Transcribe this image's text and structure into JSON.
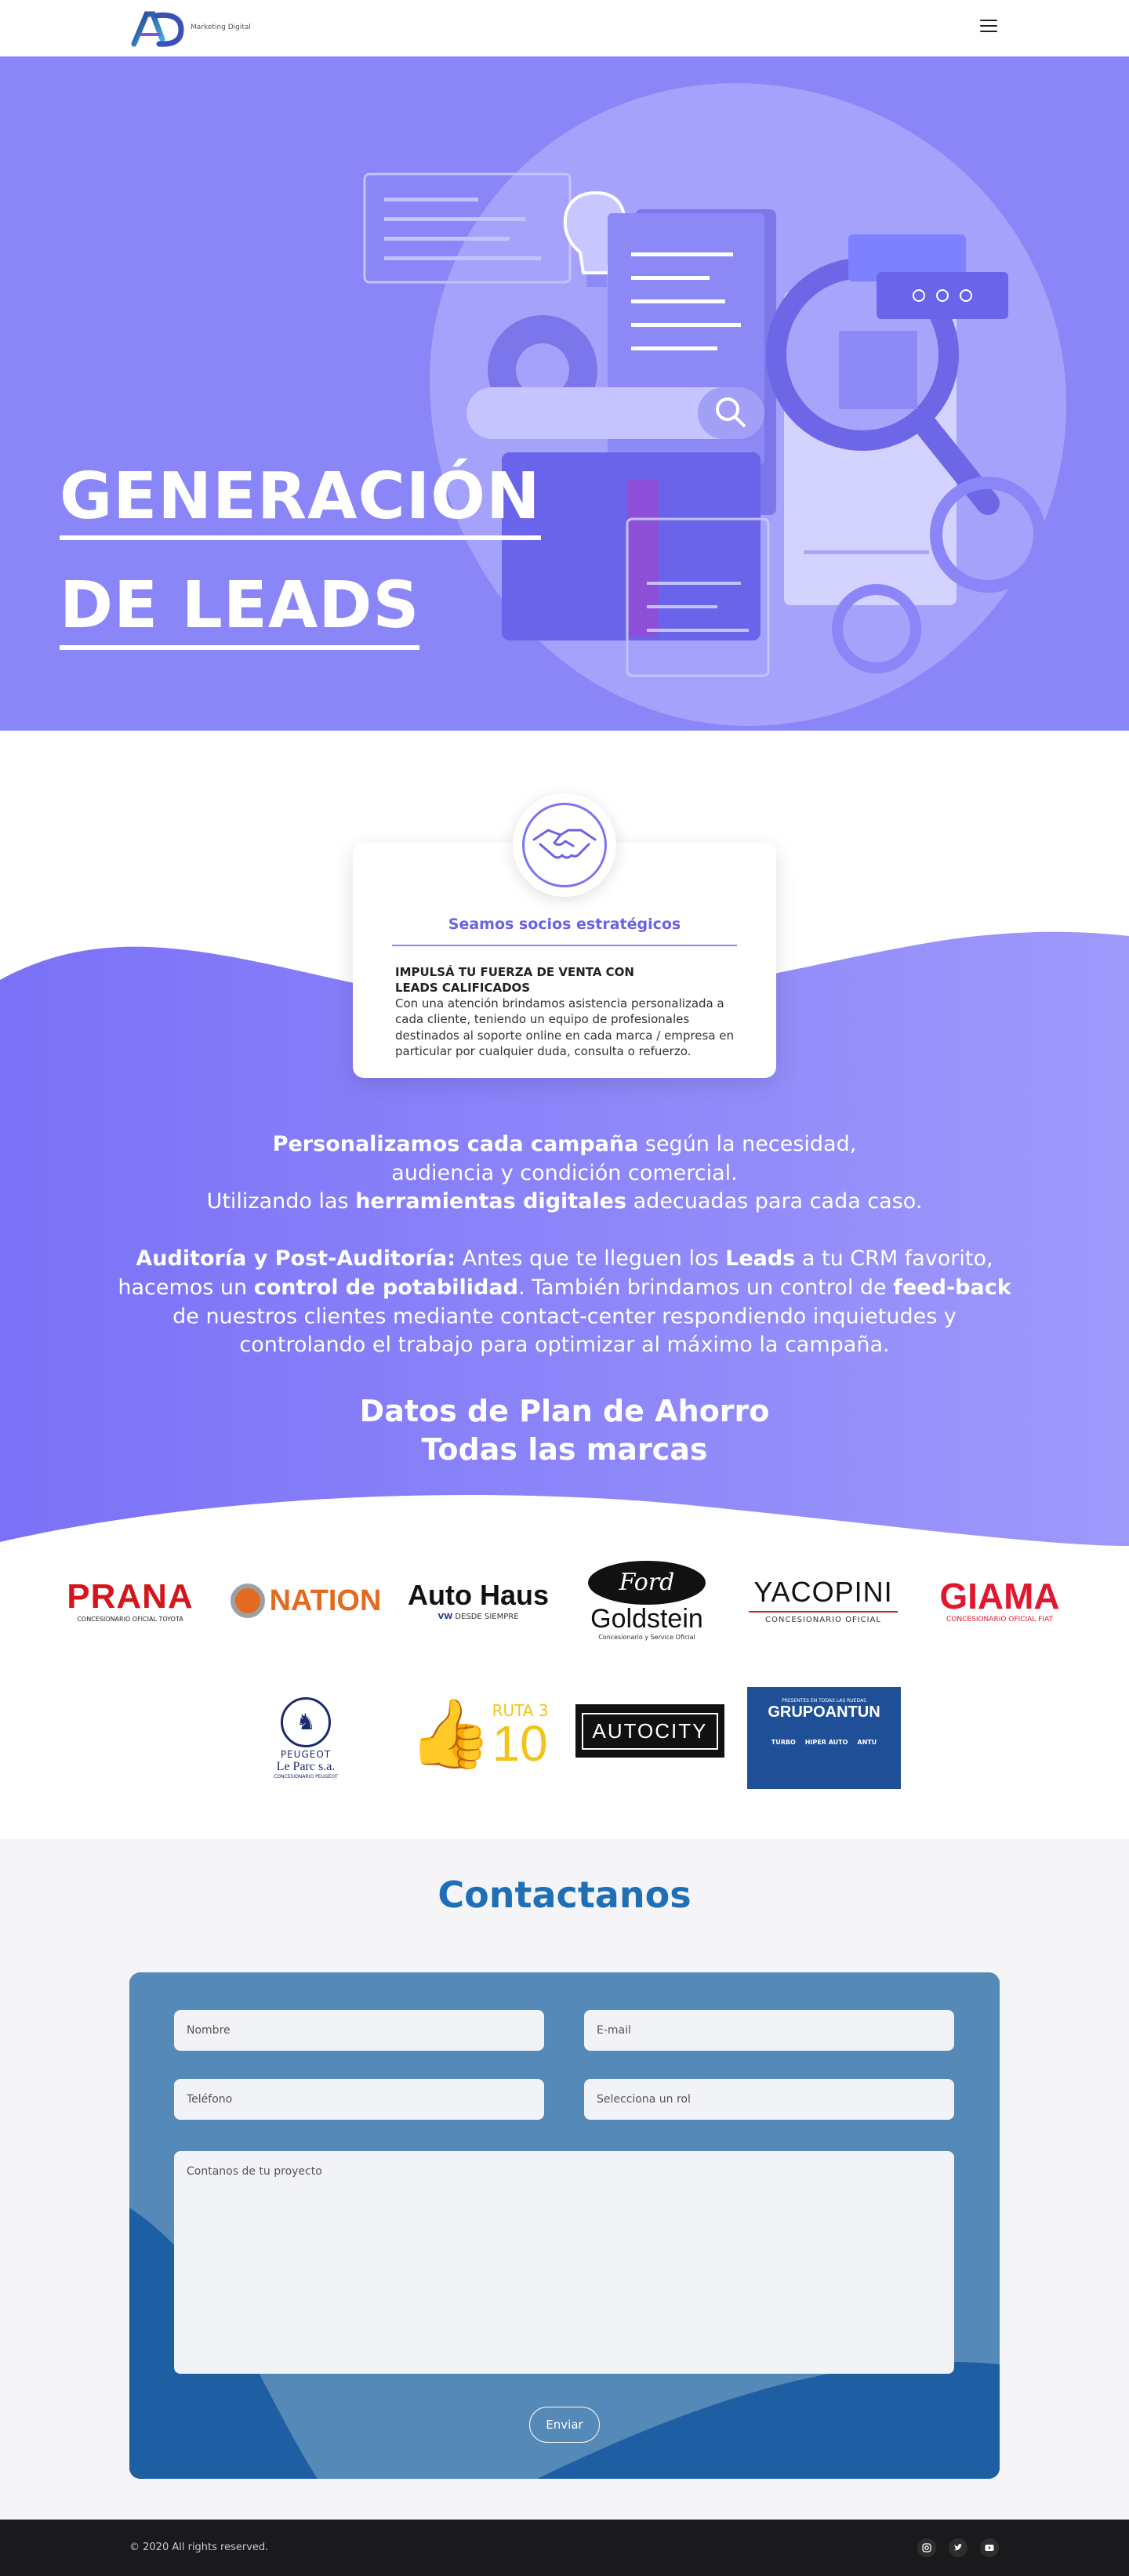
{
  "header": {
    "logo_tagline": "Marketing Digital",
    "logo_letters": "AD"
  },
  "hero": {
    "title_line1": "GENERACIÓN",
    "title_line2": "DE LEADS"
  },
  "partner_card": {
    "title": "Seamos socios estratégicos",
    "subtitle": "IMPULSÁ TU FUERZA DE VENTA CON LEADS CALIFICADOS",
    "text": "Con una atención brindamos asistencia personalizada a cada cliente, teniendo un equipo de profesionales destinados al soporte online en cada marca / empresa en particular por cualquier duda, consulta o refuerzo."
  },
  "copy": {
    "p1_bold1": "Personalizamos cada campaña",
    "p1_text1": " según la necesidad,",
    "p1_text2": "audiencia y condición comercial.",
    "p1_text3": "Utilizando las ",
    "p1_bold2": "herramientas digitales",
    "p1_text4": " adecuadas para cada caso.",
    "p2_bold1": "Auditoría y Post-Auditoría:",
    "p2_text1": " Antes que te lleguen los ",
    "p2_bold2": "Leads",
    "p2_text2": " a tu CRM favorito,",
    "p2_text3": "hacemos un ",
    "p2_bold3": "control de potabilidad",
    "p2_text4": ". También brindamos un control de ",
    "p2_bold4": "feed-back",
    "p2_text5": "de nuestros clientes mediante contact-center respondiendo inquietudes y",
    "p2_text6": "controlando el trabajo para optimizar al máximo la campaña."
  },
  "heading": {
    "line1": "Datos de Plan de Ahorro",
    "line2": "Todas las marcas"
  },
  "brands": {
    "prana": "PRANA",
    "prana_sub": "CONCESIONARIO OFICIAL TOYOTA",
    "nation": "NATION",
    "autohaus": "Auto Haus",
    "autohaus_sub": "DESDE SIEMPRE",
    "autohaus_vw": "VW",
    "goldstein_ford": "Ford",
    "goldstein": "Goldstein",
    "goldstein_sub": "Concesionario y Service Oficial",
    "yacopini": "YACOPINI",
    "yacopini_sub": "CONCESIONARIO OFICIAL",
    "giama": "GIAMA",
    "giama_sub": "CONCESIONARIO OFICIAL FIAT",
    "peugeot": "PEUGEOT",
    "leparc": "Le Parc s.a.",
    "leparc_sub": "CONCESIONARIO PEUGEOT",
    "ruta3_top": "RUTA 3",
    "ruta3_num": "10",
    "autocity": "AUTOCITY",
    "grupoantun": "GRUPOANTUN",
    "grupoantun_top": "PRESENTES EN TODAS LAS RUEDAS",
    "grupoantun_b1": "TURBO",
    "grupoantun_b2": "HIPER AUTO",
    "grupoantun_b3": "ANTU"
  },
  "contact": {
    "title": "Contactanos",
    "name_placeholder": "Nombre",
    "email_placeholder": "E-mail",
    "phone_placeholder": "Teléfono",
    "role_placeholder": "Selecciona un rol",
    "message_placeholder": "Contanos de tu proyecto",
    "submit": "Enviar"
  },
  "footer": {
    "copyright": "© 2020 All rights reserved."
  },
  "colors": {
    "hero_bg": "#8a86f8",
    "accent": "#6b62e6",
    "contact_title": "#1f6fb6",
    "footer_bg": "#1a1a1c"
  }
}
